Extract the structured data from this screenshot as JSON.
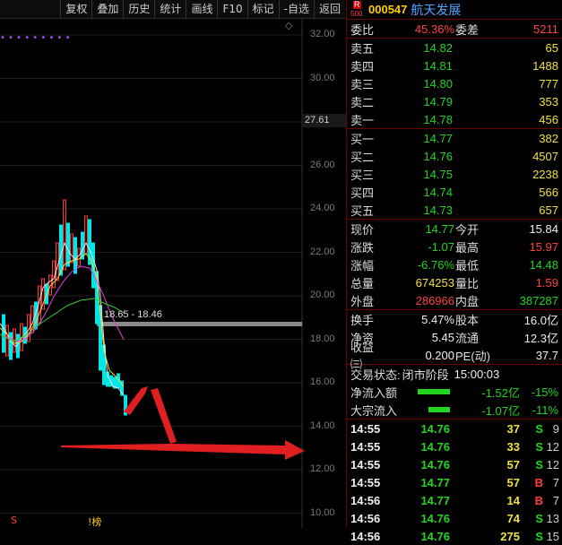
{
  "toolbar": {
    "items": [
      "复权",
      "叠加",
      "历史",
      "统计",
      "画线",
      "F10",
      "标记",
      "-自选",
      "返回"
    ]
  },
  "chart": {
    "price_axis": [
      "32.00",
      "30.00",
      "28.00",
      "26.00",
      "24.00",
      "22.00",
      "20.00",
      "18.00",
      "16.00",
      "14.00",
      "12.00",
      "10.00"
    ],
    "current_price_tag": "27.61",
    "range_label": "18.65 - 18.46",
    "marker_s": "S",
    "marker_bang": "!榜",
    "dots": "•      •      • •  • • •  • •"
  },
  "quote": {
    "badge_top": "R",
    "badge_bottom": "500",
    "code": "000547",
    "name": "航天发展",
    "weibi_label": "委比",
    "weibi_value": "45.36%",
    "weicha_label": "委差",
    "weicha_value": "5211",
    "asks": [
      {
        "label": "卖五",
        "price": "14.82",
        "vol": "65"
      },
      {
        "label": "卖四",
        "price": "14.81",
        "vol": "1488"
      },
      {
        "label": "卖三",
        "price": "14.80",
        "vol": "777"
      },
      {
        "label": "卖二",
        "price": "14.79",
        "vol": "353"
      },
      {
        "label": "卖一",
        "price": "14.78",
        "vol": "456"
      }
    ],
    "bids": [
      {
        "label": "买一",
        "price": "14.77",
        "vol": "382"
      },
      {
        "label": "买二",
        "price": "14.76",
        "vol": "4507"
      },
      {
        "label": "买三",
        "price": "14.75",
        "vol": "2238"
      },
      {
        "label": "买四",
        "price": "14.74",
        "vol": "566"
      },
      {
        "label": "买五",
        "price": "14.73",
        "vol": "657"
      }
    ],
    "stats": [
      {
        "l1": "现价",
        "v1": "14.77",
        "l2": "今开",
        "v2": "15.84",
        "c1": "c-green",
        "c2": "c-white"
      },
      {
        "l1": "涨跌",
        "v1": "-1.07",
        "l2": "最高",
        "v2": "15.97",
        "c1": "c-green",
        "c2": "c-red"
      },
      {
        "l1": "涨幅",
        "v1": "-6.76%",
        "l2": "最低",
        "v2": "14.48",
        "c1": "c-green",
        "c2": "c-green"
      },
      {
        "l1": "总量",
        "v1": "674253",
        "l2": "量比",
        "v2": "1.59",
        "c1": "c-yellow",
        "c2": "c-red"
      },
      {
        "l1": "外盘",
        "v1": "286966",
        "l2": "内盘",
        "v2": "387287",
        "c1": "c-red",
        "c2": "c-green"
      }
    ],
    "stats2": [
      {
        "l1": "换手",
        "v1": "5.47%",
        "l2": "股本",
        "v2": "16.0亿"
      },
      {
        "l1": "净资",
        "v1": "5.45",
        "l2": "流通",
        "v2": "12.3亿"
      },
      {
        "l1": "收益㈢",
        "v1": "0.200",
        "l2": "PE(动)",
        "v2": "37.7"
      }
    ],
    "trade_status_label": "交易状态:",
    "trade_status_value": "闭市阶段",
    "trade_status_time": "15:00:03",
    "flows": [
      {
        "label": "净流入额",
        "value": "-1.52亿",
        "pct": "-15%",
        "bar_fraction": 0.9
      },
      {
        "label": "大宗流入",
        "value": "-1.07亿",
        "pct": "-11%",
        "bar_fraction": 0.6
      }
    ],
    "ticks": [
      {
        "time": "14:55",
        "price": "14.76",
        "vol": "37",
        "bs": "S",
        "cnt": "9"
      },
      {
        "time": "14:55",
        "price": "14.76",
        "vol": "33",
        "bs": "S",
        "cnt": "12"
      },
      {
        "time": "14:55",
        "price": "14.76",
        "vol": "57",
        "bs": "S",
        "cnt": "12"
      },
      {
        "time": "14:55",
        "price": "14.77",
        "vol": "57",
        "bs": "B",
        "cnt": "7"
      },
      {
        "time": "14:56",
        "price": "14.77",
        "vol": "14",
        "bs": "B",
        "cnt": "7"
      },
      {
        "time": "14:56",
        "price": "14.76",
        "vol": "74",
        "bs": "S",
        "cnt": "13"
      },
      {
        "time": "14:56",
        "price": "14.76",
        "vol": "275",
        "bs": "S",
        "cnt": "15"
      }
    ]
  },
  "colors": {
    "up": "#ff4040",
    "down": "#21d421",
    "vol": "#f0e040",
    "border": "#6a0000"
  }
}
